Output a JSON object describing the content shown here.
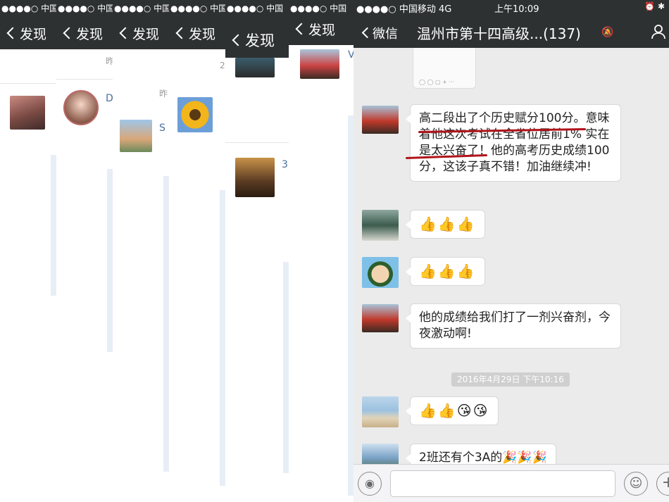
{
  "panels": [
    {
      "status": "●●●●○ 中国",
      "back": "发现",
      "faint": "",
      "extra": ""
    },
    {
      "status": "●●●●○ 中国",
      "back": "发现",
      "faint": "昨",
      "extra": "D"
    },
    {
      "status": "●●●●○ 中国移",
      "back": "发现",
      "faint": "昨",
      "extra": "S"
    },
    {
      "status": "●●●●○ 中国",
      "back": "发现",
      "faint": "2",
      "extra": ""
    },
    {
      "status": "●●●●○ 中国",
      "back": "发现",
      "faint": "",
      "extra": "3"
    },
    {
      "status": "●●●●○ 中国",
      "back": "发现",
      "faint": "",
      "extra": "V"
    }
  ],
  "chat": {
    "status": {
      "carrier": "●●●●○ 中国移动  4G",
      "time": "上午10:09"
    },
    "back_label": "微信",
    "title": "温州市第十四高级...(137)",
    "messages": [
      {
        "text": "高二段出了个历史赋分100分。意味着他这次考试在全省位居前1% 实在是太兴奋了！他的高考历史成绩100分，这该子真不错！加油继续冲!"
      },
      {
        "text": "👍👍👍"
      },
      {
        "text": "👍👍👍"
      },
      {
        "text": "他的成绩给我们打了一剂兴奋剂，今夜激动啊!"
      },
      {
        "text": "👍👍😘😘"
      },
      {
        "text": "2班还有个3A的🎉🎉🎉"
      }
    ],
    "timestamp": "2016年4月29日  下午10:16"
  },
  "colors": {
    "nav_bar": "#2e3132",
    "chat_bg": "#ebebeb",
    "underline": "#b0141b"
  }
}
